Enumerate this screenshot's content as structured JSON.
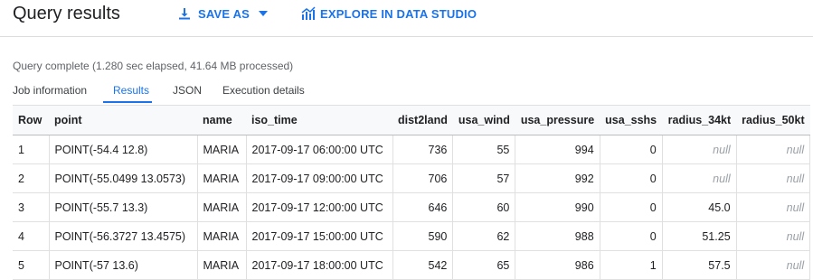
{
  "header": {
    "title": "Query results",
    "save_as_label": "SAVE AS",
    "explore_label": "EXPLORE IN DATA STUDIO"
  },
  "status": "Query complete (1.280 sec elapsed, 41.64 MB processed)",
  "tabs": [
    "Job information",
    "Results",
    "JSON",
    "Execution details"
  ],
  "active_tab": "Results",
  "table": {
    "columns": [
      "Row",
      "point",
      "name",
      "iso_time",
      "dist2land",
      "usa_wind",
      "usa_pressure",
      "usa_sshs",
      "radius_34kt",
      "radius_50kt"
    ],
    "rows": [
      [
        "1",
        "POINT(-54.4 12.8)",
        "MARIA",
        "2017-09-17 06:00:00 UTC",
        "736",
        "55",
        "994",
        "0",
        "null",
        "null"
      ],
      [
        "2",
        "POINT(-55.0499 13.0573)",
        "MARIA",
        "2017-09-17 09:00:00 UTC",
        "706",
        "57",
        "992",
        "0",
        "null",
        "null"
      ],
      [
        "3",
        "POINT(-55.7 13.3)",
        "MARIA",
        "2017-09-17 12:00:00 UTC",
        "646",
        "60",
        "990",
        "0",
        "45.0",
        "null"
      ],
      [
        "4",
        "POINT(-56.3727 13.4575)",
        "MARIA",
        "2017-09-17 15:00:00 UTC",
        "590",
        "62",
        "988",
        "0",
        "51.25",
        "null"
      ],
      [
        "5",
        "POINT(-57 13.6)",
        "MARIA",
        "2017-09-17 18:00:00 UTC",
        "542",
        "65",
        "986",
        "1",
        "57.5",
        "null"
      ]
    ]
  },
  "colors": {
    "accent": "#1a73e8",
    "border": "#e0e0e0",
    "muted": "#5f6368",
    "null_text": "#9aa0a6"
  }
}
